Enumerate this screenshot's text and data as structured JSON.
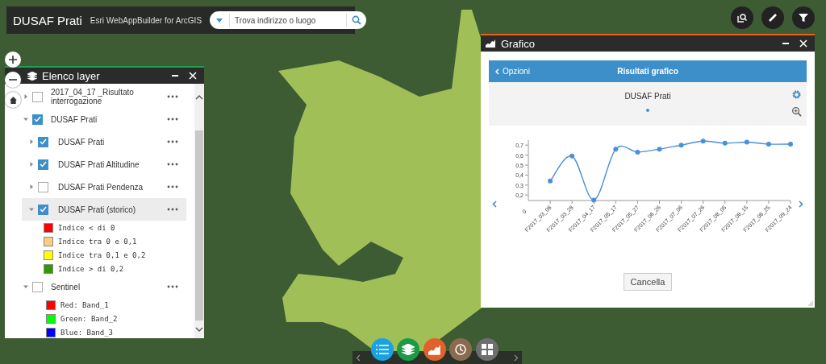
{
  "header": {
    "title": "DUSAF Prati",
    "subtitle": "Esri WebAppBuilder for ArcGIS",
    "search": {
      "placeholder": "Trova indirizzo o luogo"
    }
  },
  "layer_panel": {
    "title": "Elenco layer",
    "layers": [
      {
        "label": "2017_04_17 _Risultato interrogazione",
        "checked": false,
        "expanded": false,
        "selected": false
      },
      {
        "label": "DUSAF Prati",
        "checked": true,
        "expanded": true,
        "selected": false,
        "children": [
          {
            "label": "DUSAF Prati",
            "checked": true,
            "expanded": false,
            "selected": false
          },
          {
            "label": "DUSAF Prati Altitudine",
            "checked": true,
            "expanded": false,
            "selected": false
          },
          {
            "label": "DUSAF Prati Pendenza",
            "checked": false,
            "expanded": false,
            "selected": false
          },
          {
            "label": "DUSAF Prati (storico)",
            "checked": true,
            "expanded": true,
            "selected": true,
            "legend": [
              {
                "label": "Indice < di 0",
                "color": "#ff0000"
              },
              {
                "label": "Indice tra 0 e 0,1",
                "color": "#ffcc80"
              },
              {
                "label": "Indice tra 0,1 e 0,2",
                "color": "#ffff00"
              },
              {
                "label": "Indice > di 0,2",
                "color": "#339900"
              }
            ]
          }
        ]
      },
      {
        "label": "Sentinel",
        "checked": false,
        "expanded": true,
        "selected": false,
        "legend": [
          {
            "label": "Red: Band_1",
            "color": "#ff0000"
          },
          {
            "label": "Green: Band_2",
            "color": "#00ff00"
          },
          {
            "label": "Blue: Band_3",
            "color": "#0000ff"
          }
        ]
      }
    ]
  },
  "chart_window": {
    "title": "Grafico",
    "back_link": "Opzioni",
    "header_title": "Risultati grafico",
    "origin_label": "0",
    "cancel_button": "Cancella",
    "chart_data": {
      "type": "line",
      "title": "DUSAF Prati",
      "categories": [
        "F2017_03_08",
        "F2017_03_28",
        "F2017_04_17",
        "F2017_05_17",
        "F2017_05_27",
        "F2017_06_26",
        "F2017_07_06",
        "F2017_07_26",
        "F2017_08_05",
        "F2017_08_15",
        "F2017_08_25",
        "F2017_09_24"
      ],
      "series": [
        {
          "color": "#4a90d9",
          "marker": true,
          "values": [
            0.34,
            0.59,
            0.15,
            0.66,
            0.63,
            0.66,
            0.7,
            0.74,
            0.72,
            0.73,
            0.71,
            0.71
          ]
        }
      ],
      "ylim": [
        0.145,
        0.75
      ],
      "yticks": [
        {
          "value": 0.2,
          "label": "0,2"
        },
        {
          "value": 0.3,
          "label": "0,3"
        },
        {
          "value": 0.4,
          "label": "0,4"
        },
        {
          "value": 0.5,
          "label": "0,5"
        },
        {
          "value": 0.6,
          "label": "0,6"
        },
        {
          "value": 0.7,
          "label": "0,7"
        }
      ]
    }
  }
}
